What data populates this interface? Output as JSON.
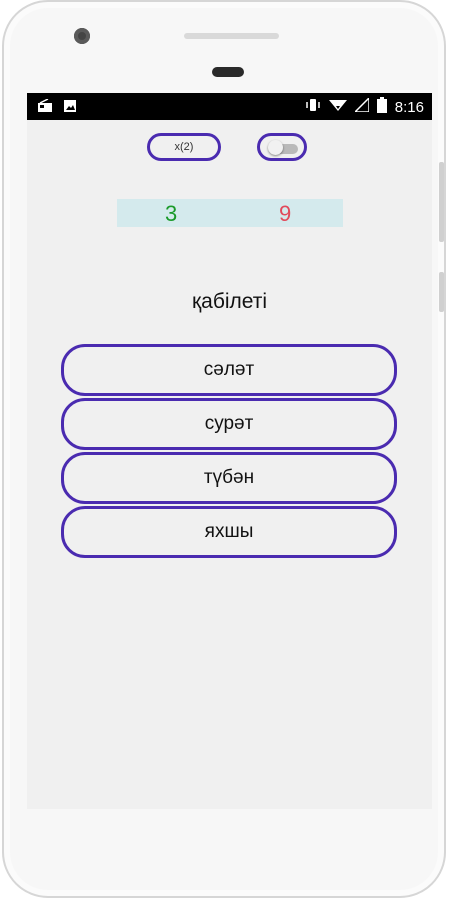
{
  "status_bar": {
    "time": "8:16",
    "icons": [
      "radio-icon",
      "image-icon",
      "vibrate-icon",
      "wifi-icon",
      "signal-icon",
      "battery-icon"
    ]
  },
  "controls": {
    "multiplier_label": "x(2)",
    "toggle_state": "off"
  },
  "score": {
    "correct": "3",
    "wrong": "9"
  },
  "question": {
    "word": "қабілеті"
  },
  "answers": [
    {
      "label": "сәләт"
    },
    {
      "label": "сурәт"
    },
    {
      "label": "түбән"
    },
    {
      "label": "яхшы"
    }
  ],
  "colors": {
    "accent": "#4a2bb0",
    "correct": "#1a9a2a",
    "wrong": "#e24a5b",
    "score_bg": "#d4eaed",
    "screen_bg": "#f0f0f0"
  }
}
